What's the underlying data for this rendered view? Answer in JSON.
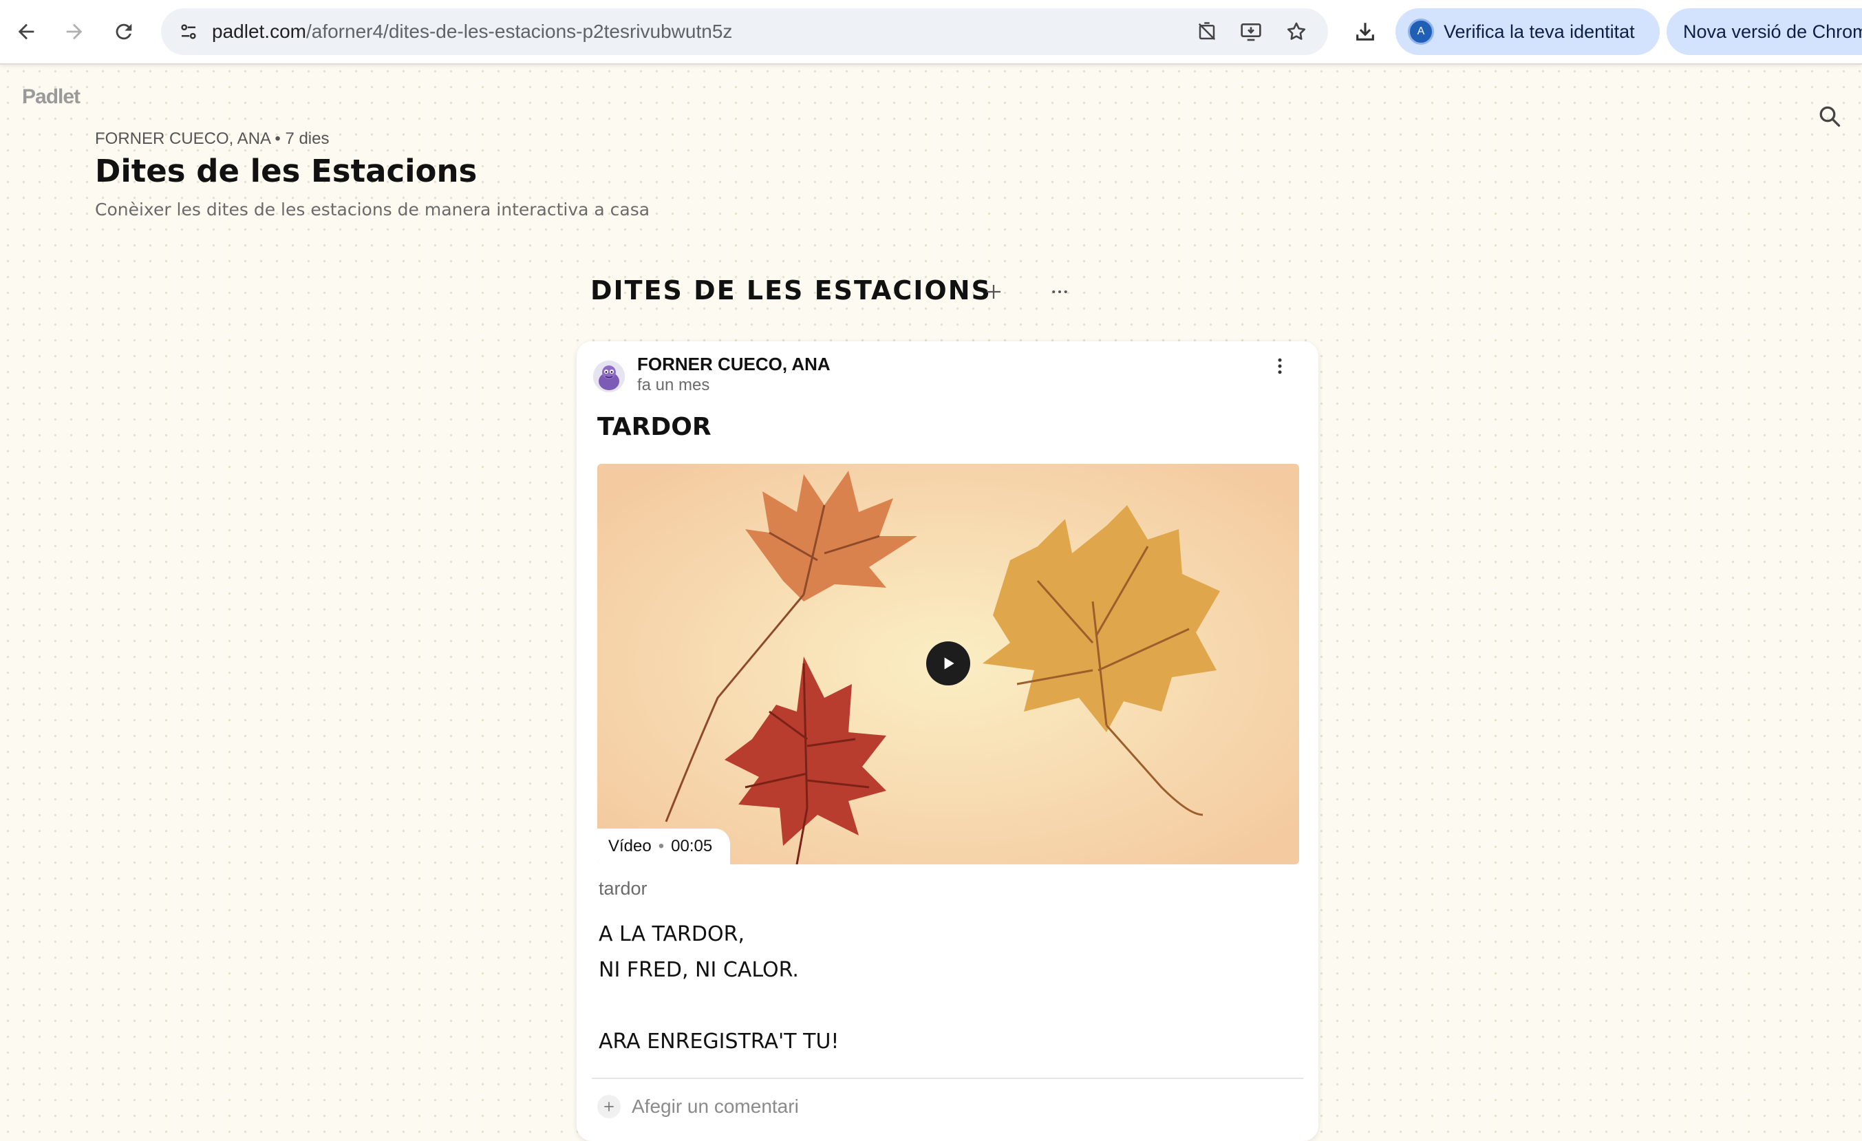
{
  "browser": {
    "url_host": "padlet.com",
    "url_path": "/aforner4/dites-de-les-estacions-p2tesrivubwutn5z",
    "profile_initial": "A",
    "verify_label": "Verifica la teva identitat",
    "new_version_label": "Nova versió de Chrom",
    "icons": [
      "back-arrow-icon",
      "forward-arrow-icon",
      "reload-icon",
      "site-settings-icon",
      "no-cast-icon",
      "install-app-icon",
      "bookmark-star-icon",
      "download-icon"
    ]
  },
  "padlet": {
    "logo": "Padlet",
    "meta": "FORNER CUECO, ANA • 7 dies",
    "title": "Dites de les Estacions",
    "description": "Conèixer les dites de les estacions de manera interactiva a casa"
  },
  "section": {
    "title": "DITES DE LES ESTACIONS",
    "add_icon": "plus-icon",
    "more_icon": "ellipsis-icon"
  },
  "post": {
    "author": "FORNER CUECO, ANA",
    "time": "fa un mes",
    "title": "TARDOR",
    "media_type": "Vídeo",
    "media_duration": "00:05",
    "caption": "tardor",
    "body": [
      "A LA TARDOR,",
      "NI FRED, NI CALOR.",
      "",
      "ARA ENREGISTRA'T TU!"
    ],
    "comment_placeholder": "Afegir un comentari"
  },
  "colors": {
    "background": "#fdfbf1",
    "chip": "#d3e3fd",
    "card": "#ffffff",
    "leaf_orange": "#d9824e",
    "leaf_red": "#b83d2e",
    "leaf_gold": "#e0a64c"
  }
}
